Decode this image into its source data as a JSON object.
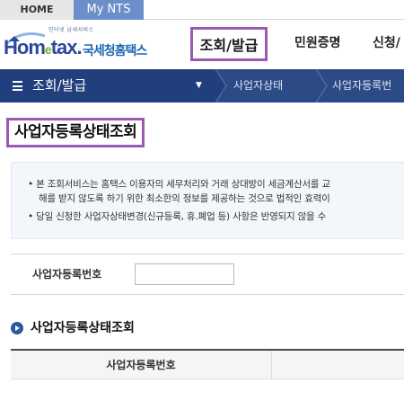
{
  "top_tabs": {
    "home": "HOME",
    "mynts": "My NTS"
  },
  "header": {
    "logo_tagline": "인터넷 납세서비스",
    "logo_text_a": "Hom",
    "logo_text_e": "e",
    "logo_text_b": "tax.",
    "logo_korean": "국세청홈택스",
    "gnb": [
      "조회/발급",
      "민원증명",
      "신청/"
    ]
  },
  "breadcrumb": {
    "title": "조회/발급",
    "items": [
      "사업자상태",
      "사업자등록번"
    ]
  },
  "page_title": "사업자등록상태조회",
  "notice": {
    "line1": "• 본 조회서비스는 홈택스 이용자의 세무처리와 거래 상대방이 세금계산서를 교",
    "line2": "해를 받지 않도록 하기 위한 최소한의 정보를 제공하는 것으로 법적인 효력이",
    "line3": "• 당일 신청한 사업자상태변경(신규등록, 휴.폐업 등) 사항은 반영되지 않을 수"
  },
  "form": {
    "label": "사업자등록번호",
    "value": ""
  },
  "section": {
    "title": "사업자등록상태조회"
  },
  "table": {
    "headers": [
      "사업자등록번호"
    ]
  },
  "colors": {
    "nav_bar": "#2c4a86",
    "highlight": "#9b59b6",
    "tab_active": "#6b8fc9"
  }
}
